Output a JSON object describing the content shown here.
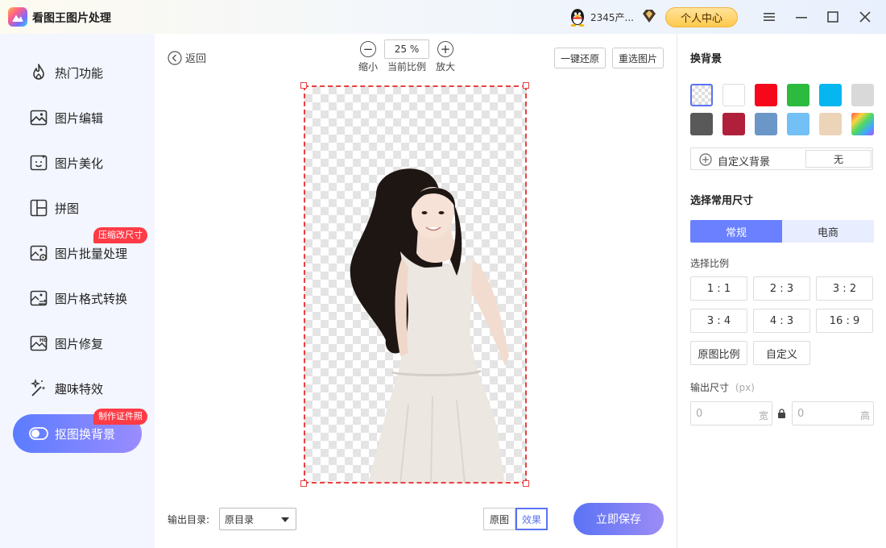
{
  "app": {
    "title": "看图王图片处理",
    "user_name": "2345产...",
    "user_center_label": "个人中心"
  },
  "sidebar": {
    "items": [
      {
        "label": "热门功能",
        "icon": "fire-icon"
      },
      {
        "label": "图片编辑",
        "icon": "image-edit-icon"
      },
      {
        "label": "图片美化",
        "icon": "image-beautify-icon"
      },
      {
        "label": "拼图",
        "icon": "collage-icon"
      },
      {
        "label": "图片批量处理",
        "icon": "batch-icon",
        "badge": "压缩改尺寸"
      },
      {
        "label": "图片格式转换",
        "icon": "convert-icon"
      },
      {
        "label": "图片修复",
        "icon": "hd-repair-icon"
      },
      {
        "label": "趣味特效",
        "icon": "magic-wand-icon"
      },
      {
        "label": "抠图换背景",
        "icon": "toggle-icon",
        "badge": "制作证件照",
        "active": true
      }
    ]
  },
  "toolbar": {
    "back_label": "返回",
    "zoom_out_label": "缩小",
    "zoom_value": "25 %",
    "zoom_caption": "当前比例",
    "zoom_in_label": "放大",
    "restore_label": "一键还原",
    "reselect_label": "重选图片"
  },
  "bottom": {
    "output_dir_label": "输出目录:",
    "output_dir_value": "原目录",
    "original_label": "原图",
    "effect_label": "效果",
    "save_label": "立即保存"
  },
  "panel": {
    "bg_title": "换背景",
    "swatches": [
      "transparent",
      "#ffffff",
      "#f5081c",
      "#2dbb3f",
      "#06b6ef",
      "#d9d9d9",
      "#595959",
      "#b0203a",
      "#6b96c8",
      "#72c0f6",
      "#ecd4b9",
      "rainbow"
    ],
    "custom_bg_label": "自定义背景",
    "custom_bg_value": "无",
    "size_title": "选择常用尺寸",
    "tab_normal": "常规",
    "tab_ecommerce": "电商",
    "ratio_title": "选择比例",
    "ratios": [
      "1 : 1",
      "2 : 3",
      "3 : 2",
      "3 : 4",
      "4 : 3",
      "16 : 9",
      "原图比例",
      "自定义"
    ],
    "output_size_label": "输出尺寸",
    "output_size_unit": "(px)",
    "width_value": "0",
    "width_unit": "宽",
    "height_value": "0",
    "height_unit": "高"
  },
  "colors": {
    "accent": "#6a80ff",
    "badge": "#ff3b46",
    "selection": "#e84040"
  }
}
